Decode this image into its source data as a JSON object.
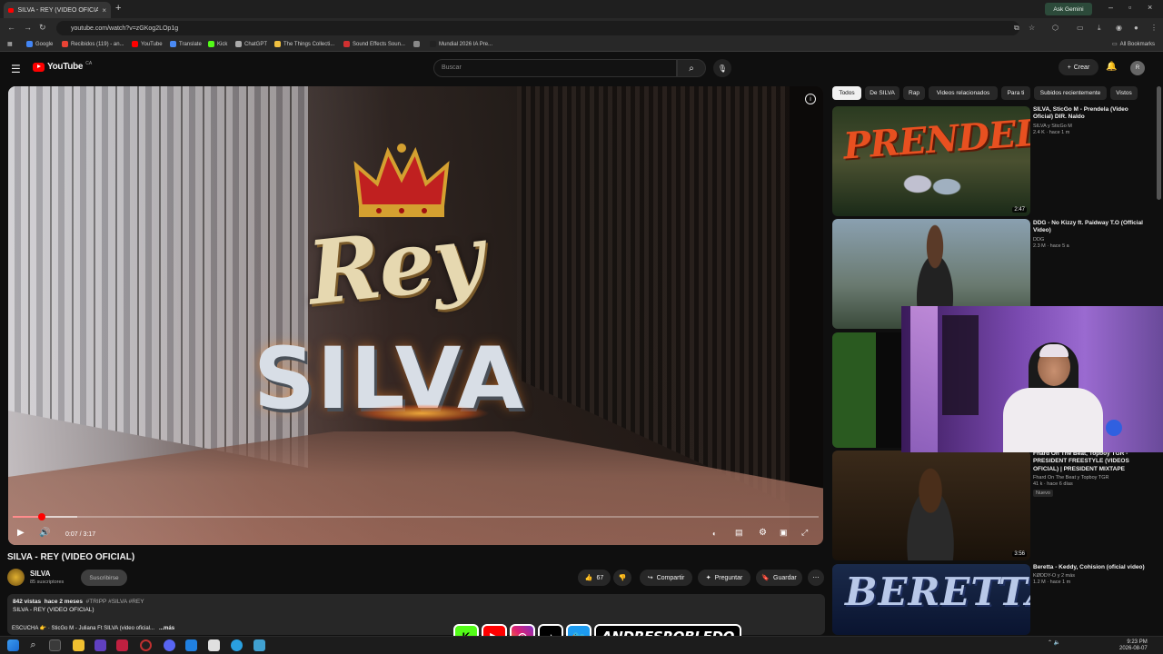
{
  "browser": {
    "tab_title": "SILVA - REY (VIDEO OFICIAL)",
    "new_tab": "+",
    "ask_gemini": "Ask Gemini",
    "url": "youtube.com/watch?v=zGKog2LOp1g",
    "all_bookmarks": "All Bookmarks",
    "bookmarks": [
      {
        "label": "Google",
        "color": "#4285f4"
      },
      {
        "label": "Recibidos (119) - an...",
        "color": "#ea4335"
      },
      {
        "label": "YouTube",
        "color": "#ff0000"
      },
      {
        "label": "Translate",
        "color": "#4a8af4"
      },
      {
        "label": "Kick",
        "color": "#53fc18"
      },
      {
        "label": "ChatGPT",
        "color": "#aaaaaa"
      },
      {
        "label": "The Things Collecti...",
        "color": "#f0c040"
      },
      {
        "label": "Sound Effects Soun...",
        "color": "#d03030"
      },
      {
        "label": "",
        "color": "#888888"
      },
      {
        "label": "Mundial 2026 IA Pre...",
        "color": "#222222"
      }
    ]
  },
  "youtube": {
    "logo_text": "YouTube",
    "country": "CA",
    "search_placeholder": "Buscar",
    "create_label": "Crear",
    "avatar_initial": "R"
  },
  "player": {
    "time": "0:07 / 3:17",
    "progress": 0.036,
    "buffered": 0.08,
    "overlay_word1": "Rey",
    "overlay_word2": "SILVA"
  },
  "video": {
    "title": "SILVA - REY (VIDEO OFICIAL)",
    "channel": "SILVA",
    "subscribers": "85 suscriptores",
    "subscribe_label": "Suscribirse",
    "likes": "67",
    "share_label": "Compartir",
    "ask_label": "Preguntar",
    "save_label": "Guardar",
    "views": "842 vistas",
    "age": "hace 2 meses",
    "hashtags": "#TRIPP #SILVA #REY",
    "desc_line": "SILVA - REY (VIDEO OFICIAL)",
    "desc_listen": "ESCUCHA",
    "desc_link": "SticGo M - Juliana Ft SILVA (video oficial...",
    "more_label": "...más"
  },
  "sidebar": {
    "chips": [
      "Todos",
      "De SILVA",
      "Rap",
      "Videos relacionados",
      "Para ti",
      "Subidos recientemente",
      "Vistos"
    ],
    "videos": [
      {
        "title": "SILVA, SticGo M - Prendela (Video Oficial) DIR. Naldo",
        "channel": "SILVA y SticGo M",
        "stats": "2.4 K · hace 1 m",
        "duration": "2:47",
        "thumb_text": "PRENDELA"
      },
      {
        "title": "DDG - No Kizzy ft. Paidway T.O (Official Video)",
        "channel": "DDG",
        "stats": "2.3 M · hace 5 a",
        "duration": "",
        "thumb_text": ""
      },
      {
        "title": "Fhard On The Beat, Topboy TGR - PRESIDENT FREESTYLE (VIDEOS OFICIAL) | PRESIDENT MIXTAPE",
        "channel": "Fhard On The Beat y Topboy TGR",
        "stats": "41 k · hace 6 días",
        "duration": "3:56",
        "badge": "Nuevo"
      },
      {
        "title": "Beretta - Keddy, Cohision (oficial video)",
        "channel": "KØDDY-O y 2 más",
        "stats": "1.2 M · hace 1 m",
        "duration": "",
        "thumb_text": "BERETTA"
      }
    ]
  },
  "overlay": {
    "handle": "ANDRESROBLEDO"
  },
  "taskbar": {
    "time": "9:23 PM",
    "date": "2026-08-07"
  }
}
